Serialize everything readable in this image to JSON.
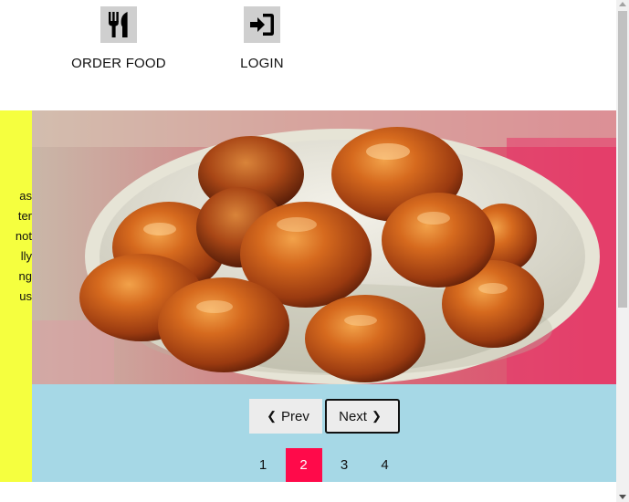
{
  "nav": {
    "order_food": {
      "label": "ORDER FOOD",
      "icon": "fork-knife-icon"
    },
    "login": {
      "label": "LOGIN",
      "icon": "sign-in-icon"
    }
  },
  "slide": {
    "text_fragments": [
      "as",
      "ter",
      "not",
      "lly",
      "ng",
      "us"
    ],
    "image": "gulab-jamun-photo"
  },
  "controls": {
    "prev_label": "Prev",
    "next_label": "Next",
    "prev_chevron": "❮",
    "next_chevron": "❯",
    "pages": [
      "1",
      "2",
      "3",
      "4"
    ],
    "active_page": "2"
  },
  "colors": {
    "text_panel": "#f5ff3f",
    "controls_bg": "#a6d8e6",
    "active_page": "#ff0a4a",
    "icon_bg": "#cfcfcf"
  }
}
